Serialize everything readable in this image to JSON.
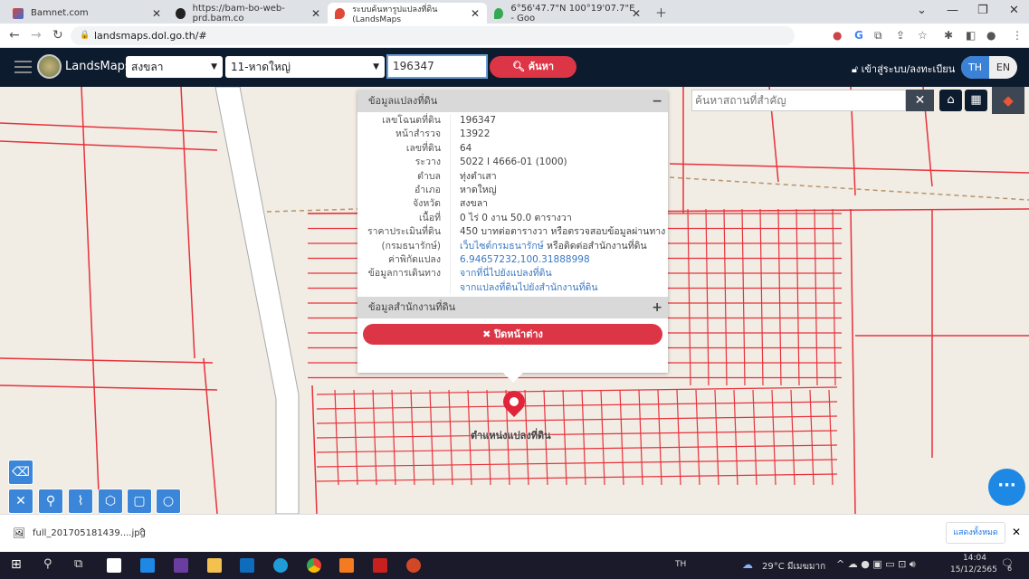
{
  "browser": {
    "tabs": [
      {
        "title": "Bamnet.com",
        "color": "#d9443a"
      },
      {
        "title": "https://bam-bo-web-prd.bam.co",
        "color": "#222"
      },
      {
        "title": "ระบบค้นหารูปแปลงที่ดิน (LandsMaps",
        "color": "#e0483a",
        "active": true
      },
      {
        "title": "6°56'47.7\"N 100°19'07.7\"E - Goo",
        "color": "#34a853"
      }
    ],
    "url": "landsmaps.dol.go.th/#"
  },
  "header": {
    "brand": "LandsMaps",
    "province": "สงขลา",
    "district": "11-หาดใหญ่",
    "parcel_no": "196347",
    "search_label": "ค้นหา",
    "login_label": "เข้าสู่ระบบ/ลงทะเบียน",
    "lang": [
      "TH",
      "EN"
    ],
    "active_lang": "TH"
  },
  "panel": {
    "title": "ข้อมูลแปลงที่ดิน",
    "rows": [
      {
        "k": "เลขโฉนดที่ดิน",
        "v": "196347"
      },
      {
        "k": "หน้าสำรวจ",
        "v": "13922"
      },
      {
        "k": "เลขที่ดิน",
        "v": "64"
      },
      {
        "k": "ระวาง",
        "v": "5022 I 4666-01 (1000)"
      },
      {
        "k": "ตำบล",
        "v": "ทุ่งตำเสา"
      },
      {
        "k": "อำเภอ",
        "v": "หาดใหญ่"
      },
      {
        "k": "จังหวัด",
        "v": "สงขลา"
      },
      {
        "k": "เนื้อที่",
        "v": "0 ไร่ 0 งาน 50.0 ตารางวา"
      },
      {
        "k": "ราคาประเมินที่ดิน",
        "v": "450 บาทต่อตารางวา หรือตรวจสอบข้อมูลผ่านทาง"
      },
      {
        "k": "(กรมธนารักษ์)",
        "v": "เว็บไซต์กรมธนารักษ์",
        "v2": " หรือติดต่อสำนักงานที่ดิน"
      },
      {
        "k": "ค่าพิกัดแปลง",
        "v": "6.94657232,100.31888998",
        "link": true
      },
      {
        "k": "ข้อมูลการเดินทาง",
        "v": "จากที่นี่ไปยังแปลงที่ดิน",
        "link": true
      },
      {
        "k": "",
        "v": "จากแปลงที่ดินไปยังสำนักงานที่ดิน",
        "link": true
      }
    ],
    "office_title": "ข้อมูลสำนักงานที่ดิน",
    "close_label": "ปิดหน้าต่าง"
  },
  "map": {
    "place_search_placeholder": "ค้นหาสถานที่สำคัญ",
    "pin_label": "ตำแหน่งแปลงที่ดิน",
    "parcel_color": "#e8323c",
    "bg_color": "#f1ece4"
  },
  "download": {
    "file": "full_201705181439....jpg",
    "show_all": "แสดงทั้งหมด"
  },
  "taskbar": {
    "lang": "TH",
    "weather": "29°C มีเมฆมาก",
    "time": "14:04",
    "date": "15/12/2565",
    "notif": "6"
  }
}
